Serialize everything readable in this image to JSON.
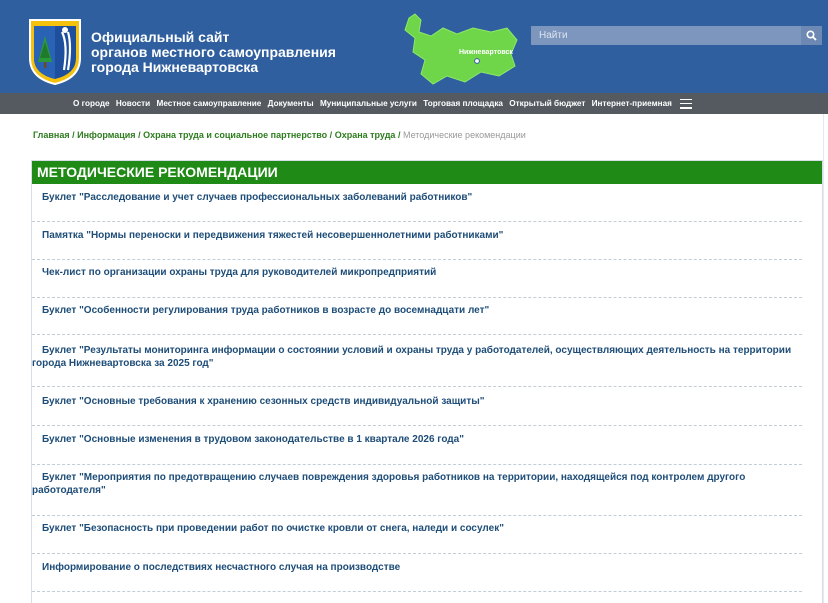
{
  "header": {
    "title_lines": [
      "Официальный сайт",
      "органов местного самоуправления",
      "города Нижневартовска"
    ],
    "map_label": "Нижневартовск",
    "search_placeholder": "Найти",
    "logo_icon": "coat-of-arms-icon",
    "search_icon": "search-icon",
    "colors": {
      "header_bg": "#2f5f9e",
      "nav_bg": "#555a61",
      "accent_green": "#1f8a16",
      "link_blue": "#1e4d78"
    }
  },
  "nav": {
    "items": [
      "О городе",
      "Новости",
      "Местное самоуправление",
      "Документы",
      "Муниципальные услуги",
      "Торговая площадка",
      "Открытый бюджет",
      "Интернет-приемная"
    ],
    "menu_icon": "hamburger-icon"
  },
  "breadcrumb": {
    "items": [
      "Главная",
      "Информация",
      "Охрана труда и социальное партнерство",
      "Охрана труда"
    ],
    "separator": "/",
    "current": "Методические рекомендации"
  },
  "main": {
    "heading": "МЕТОДИЧЕСКИЕ РЕКОМЕНДАЦИИ",
    "documents": [
      "Буклет \"Расследование и учет случаев профессиональных заболеваний работников\"",
      "Памятка \"Нормы переноски и передвижения тяжестей несовершеннолетними работниками\"",
      "Чек-лист по организации охраны труда для руководителей микропредприятий",
      "Буклет \"Особенности регулирования труда работников в возрасте до восемнадцати лет\"",
      "Буклет \"Результаты мониторинга информации о состоянии условий и охраны труда у работодателей, осуществляющих деятельность на территории города Нижневартовска за 2025 год\"",
      "Буклет \"Основные требования к хранению сезонных средств индивидуальной защиты\"",
      "Буклет \"Основные изменения в трудовом законодательстве в 1 квартале 2026 года\"",
      "Буклет \"Мероприятия по предотвращению случаев повреждения здоровья работников на территории, находящейся под контролем другого работодателя\"",
      "Буклет \"Безопасность при проведении работ по очистке кровли от снега, наледи и сосулек\"",
      "Информирование о последствиях несчастного случая на производстве"
    ]
  }
}
